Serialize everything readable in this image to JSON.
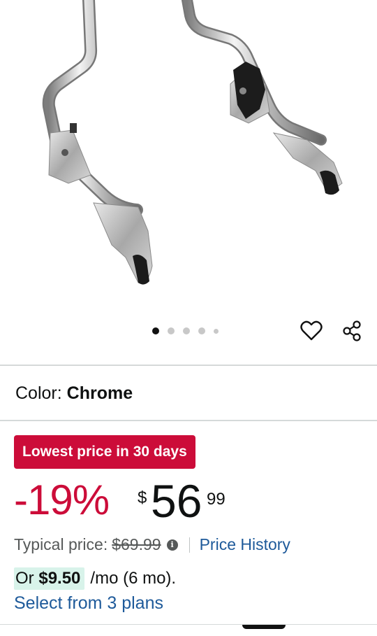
{
  "gallery": {
    "image_alt": "Chrome detachable sissy bar uprights with docking hardware",
    "dot_count": 5,
    "active_index": 0
  },
  "actions": {
    "wishlist_icon": "heart-outline-icon",
    "share_icon": "share-icon"
  },
  "variation": {
    "label": "Color: ",
    "value": "Chrome"
  },
  "deal": {
    "badge": "Lowest price in 30 days"
  },
  "price": {
    "discount": "-19%",
    "currency": "$",
    "whole": "56",
    "fraction": "99",
    "typical_label": "Typical price:",
    "typical_value": "$69.99",
    "history_link": "Price History"
  },
  "installment": {
    "prefix": "Or",
    "amount": "$9.50",
    "suffix": "/mo (6 mo).",
    "plans_link": "Select from 3 plans"
  },
  "colors": {
    "deal_red": "#cc0c39",
    "link_blue": "#1e5a9a",
    "installment_highlight": "#d8f3ea"
  }
}
